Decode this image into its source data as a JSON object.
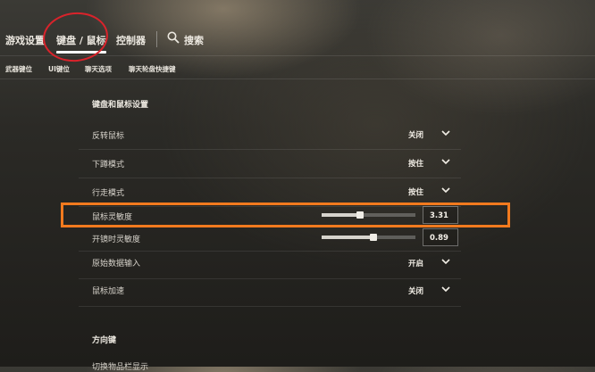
{
  "tabs": [
    {
      "label": "游戏设置"
    },
    {
      "label": "键盘 / 鼠标"
    },
    {
      "label": "控制器"
    }
  ],
  "search": {
    "label": "搜索",
    "icon": "search-icon"
  },
  "subtabs": [
    {
      "label": "武器键位"
    },
    {
      "label": "UI键位"
    },
    {
      "label": "聊天选项"
    },
    {
      "label": "聊天轮盘快捷键"
    }
  ],
  "section1": {
    "title": "键盘和鼠标设置"
  },
  "rows": [
    {
      "label": "反转鼠标",
      "value": "关闭"
    },
    {
      "label": "下蹲模式",
      "value": "按住"
    },
    {
      "label": "行走模式",
      "value": "按住"
    },
    {
      "label": "鼠标灵敏度",
      "value": "3.31",
      "slider": 0.41
    },
    {
      "label": "开镜时灵敏度",
      "value": "0.89",
      "slider": 0.55
    },
    {
      "label": "原始数据输入",
      "value": "开启"
    },
    {
      "label": "鼠标加速",
      "value": "关闭"
    }
  ],
  "section2": {
    "title": "方向键"
  },
  "cut_row": {
    "label": "切换物品栏显示"
  },
  "colors": {
    "annotation_circle": "#d9232b",
    "annotation_box": "#f27a1e"
  }
}
